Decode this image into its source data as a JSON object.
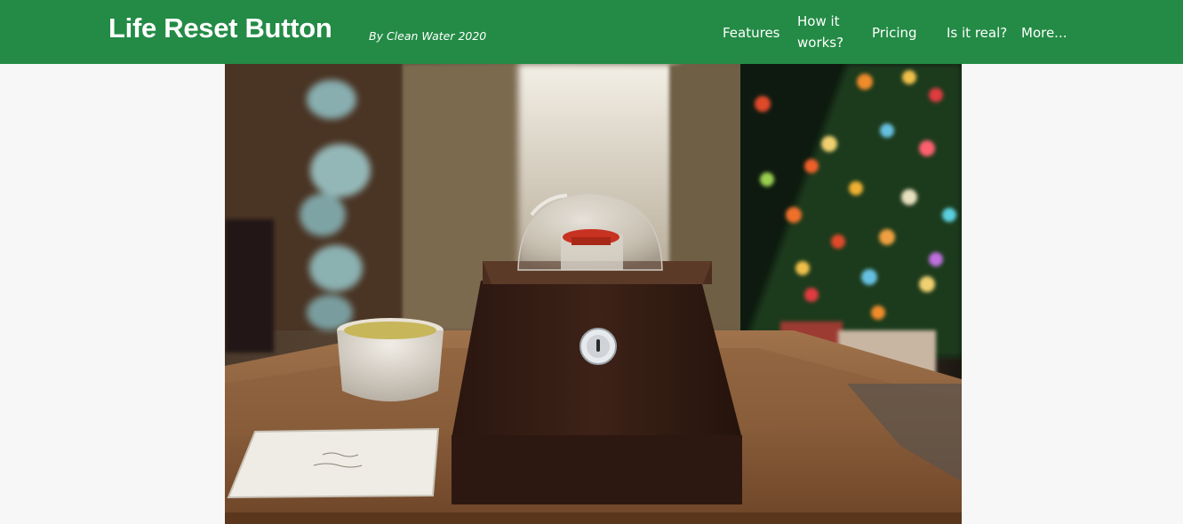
{
  "site": {
    "title": "Life Reset Button",
    "byline_prefix": "By Clean Water ",
    "byline_year": "2020"
  },
  "nav": {
    "items": [
      {
        "label": "Features"
      },
      {
        "label": "How it works?"
      },
      {
        "label": "Pricing"
      },
      {
        "label": "Is it real?"
      },
      {
        "label": "More..."
      }
    ]
  },
  "hero": {
    "image": "photo of a wooden reset-button box with a glass dome and red button, a key lock, a white tea cup, a note card, and a decorated Christmas tree in the background",
    "colors": {
      "navbar": "#238b45",
      "page_background": "#f7f7f7"
    }
  }
}
